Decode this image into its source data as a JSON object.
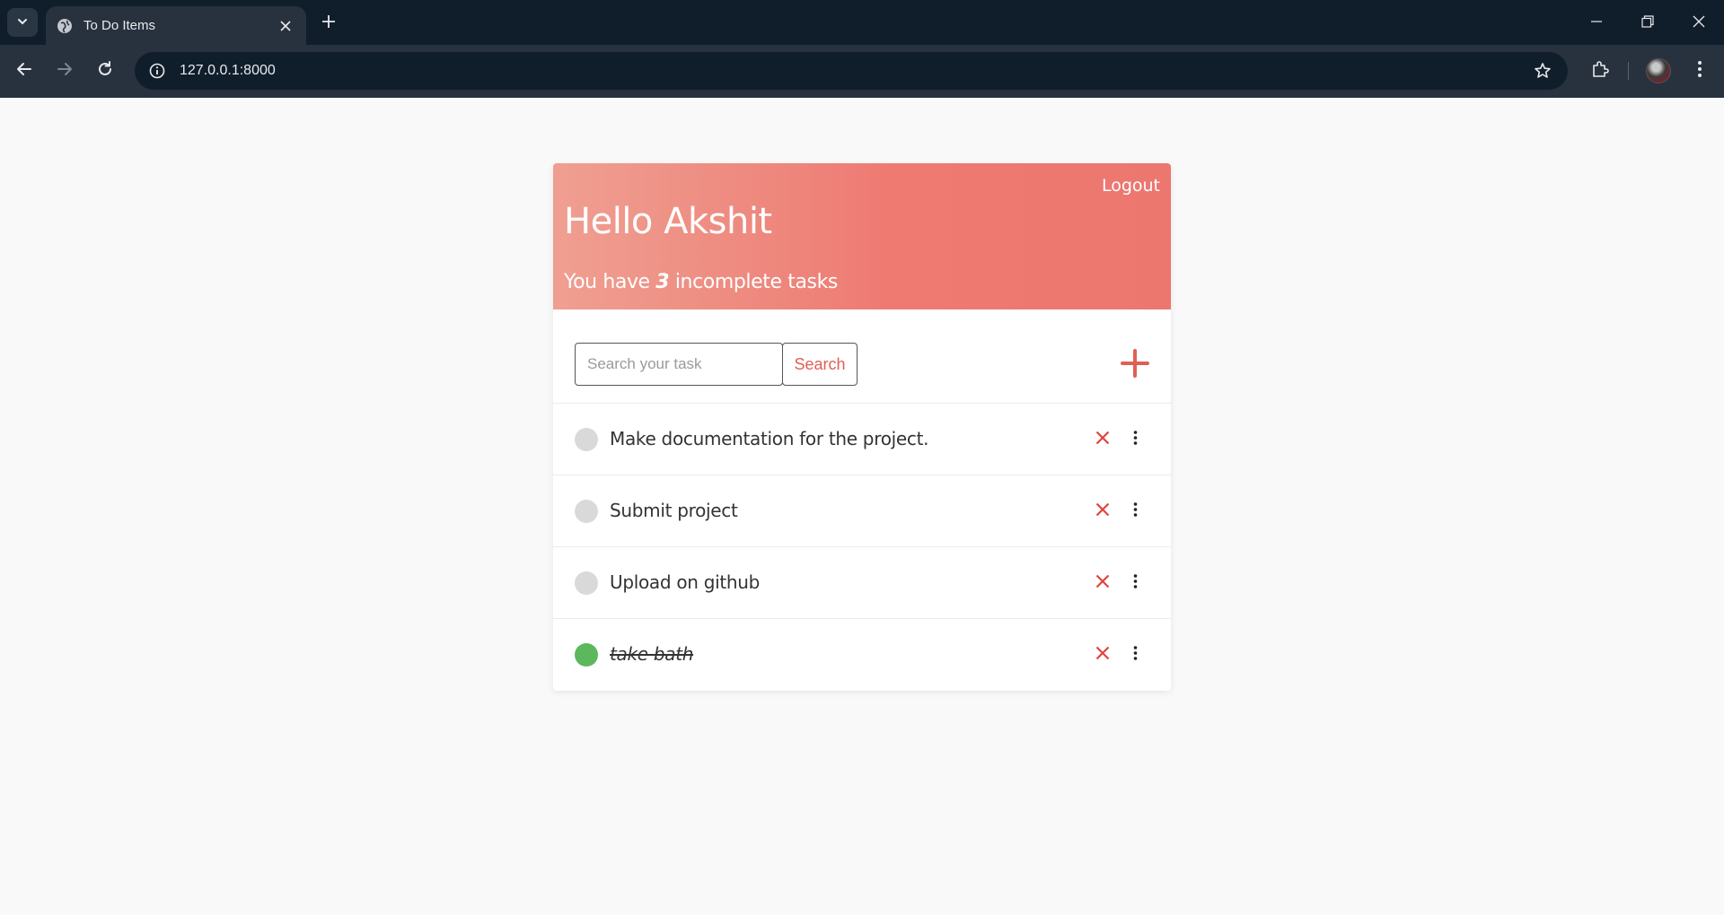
{
  "browser": {
    "tab_title": "To Do Items",
    "url": "127.0.0.1:8000"
  },
  "header": {
    "logout_label": "Logout",
    "greeting": "Hello Akshit",
    "summary_prefix": "You have",
    "incomplete_count": "3",
    "summary_suffix": "incomplete tasks"
  },
  "search": {
    "placeholder": "Search your task",
    "value": "",
    "button_label": "Search"
  },
  "tasks": [
    {
      "title": "Make documentation for the project.",
      "complete": false
    },
    {
      "title": "Submit project",
      "complete": false
    },
    {
      "title": "Upload on github",
      "complete": false
    },
    {
      "title": "take bath",
      "complete": true
    }
  ],
  "colors": {
    "header_gradient_start": "#ef9f91",
    "header_gradient_end": "#eb776f",
    "accent_red": "#e05f55",
    "complete_green": "#5cb85c",
    "incomplete_gray": "#d9d9d9"
  },
  "icons": {
    "add": "plus-icon",
    "delete": "close-x-icon",
    "more": "vertical-dots-icon"
  }
}
